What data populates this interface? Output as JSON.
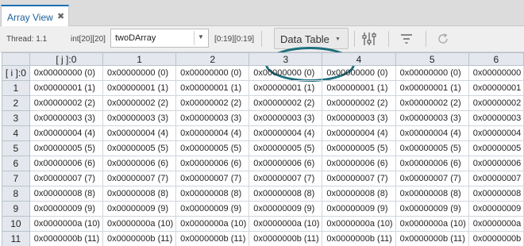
{
  "tab": {
    "label": "Array View",
    "close": "✖"
  },
  "toolbar": {
    "thread": "Thread: 1.1",
    "type": "int[20][20]",
    "expression": "twoDArray",
    "range": "[0:19][0:19]",
    "view_mode": "Data Table"
  },
  "icons": [
    "sliders-icon",
    "filter-icon",
    "refresh-icon"
  ],
  "accent_color": "#1e6f7d",
  "table": {
    "corner": "",
    "columns": [
      "[ j ]:0",
      "1",
      "2",
      "3",
      "4",
      "5",
      "6"
    ],
    "row_headers": [
      "[ i ]:0",
      "1",
      "2",
      "3",
      "4",
      "5",
      "6",
      "7",
      "8",
      "9",
      "10",
      "11"
    ],
    "rows": [
      [
        "0x00000000 (0)",
        "0x00000000 (0)",
        "0x00000000 (0)",
        "0x00000000 (0)",
        "0x00000000 (0)",
        "0x00000000 (0)",
        "0x00000000"
      ],
      [
        "0x00000001 (1)",
        "0x00000001 (1)",
        "0x00000001 (1)",
        "0x00000001 (1)",
        "0x00000001 (1)",
        "0x00000001 (1)",
        "0x00000001"
      ],
      [
        "0x00000002 (2)",
        "0x00000002 (2)",
        "0x00000002 (2)",
        "0x00000002 (2)",
        "0x00000002 (2)",
        "0x00000002 (2)",
        "0x00000002"
      ],
      [
        "0x00000003 (3)",
        "0x00000003 (3)",
        "0x00000003 (3)",
        "0x00000003 (3)",
        "0x00000003 (3)",
        "0x00000003 (3)",
        "0x00000003"
      ],
      [
        "0x00000004 (4)",
        "0x00000004 (4)",
        "0x00000004 (4)",
        "0x00000004 (4)",
        "0x00000004 (4)",
        "0x00000004 (4)",
        "0x00000004"
      ],
      [
        "0x00000005 (5)",
        "0x00000005 (5)",
        "0x00000005 (5)",
        "0x00000005 (5)",
        "0x00000005 (5)",
        "0x00000005 (5)",
        "0x00000005"
      ],
      [
        "0x00000006 (6)",
        "0x00000006 (6)",
        "0x00000006 (6)",
        "0x00000006 (6)",
        "0x00000006 (6)",
        "0x00000006 (6)",
        "0x00000006"
      ],
      [
        "0x00000007 (7)",
        "0x00000007 (7)",
        "0x00000007 (7)",
        "0x00000007 (7)",
        "0x00000007 (7)",
        "0x00000007 (7)",
        "0x00000007"
      ],
      [
        "0x00000008 (8)",
        "0x00000008 (8)",
        "0x00000008 (8)",
        "0x00000008 (8)",
        "0x00000008 (8)",
        "0x00000008 (8)",
        "0x00000008"
      ],
      [
        "0x00000009 (9)",
        "0x00000009 (9)",
        "0x00000009 (9)",
        "0x00000009 (9)",
        "0x00000009 (9)",
        "0x00000009 (9)",
        "0x00000009"
      ],
      [
        "0x0000000a (10)",
        "0x0000000a (10)",
        "0x0000000a (10)",
        "0x0000000a (10)",
        "0x0000000a (10)",
        "0x0000000a (10)",
        "0x0000000a"
      ],
      [
        "0x0000000b (11)",
        "0x0000000b (11)",
        "0x0000000b (11)",
        "0x0000000b (11)",
        "0x0000000b (11)",
        "0x0000000b (11)",
        "0x0000000b"
      ]
    ]
  }
}
